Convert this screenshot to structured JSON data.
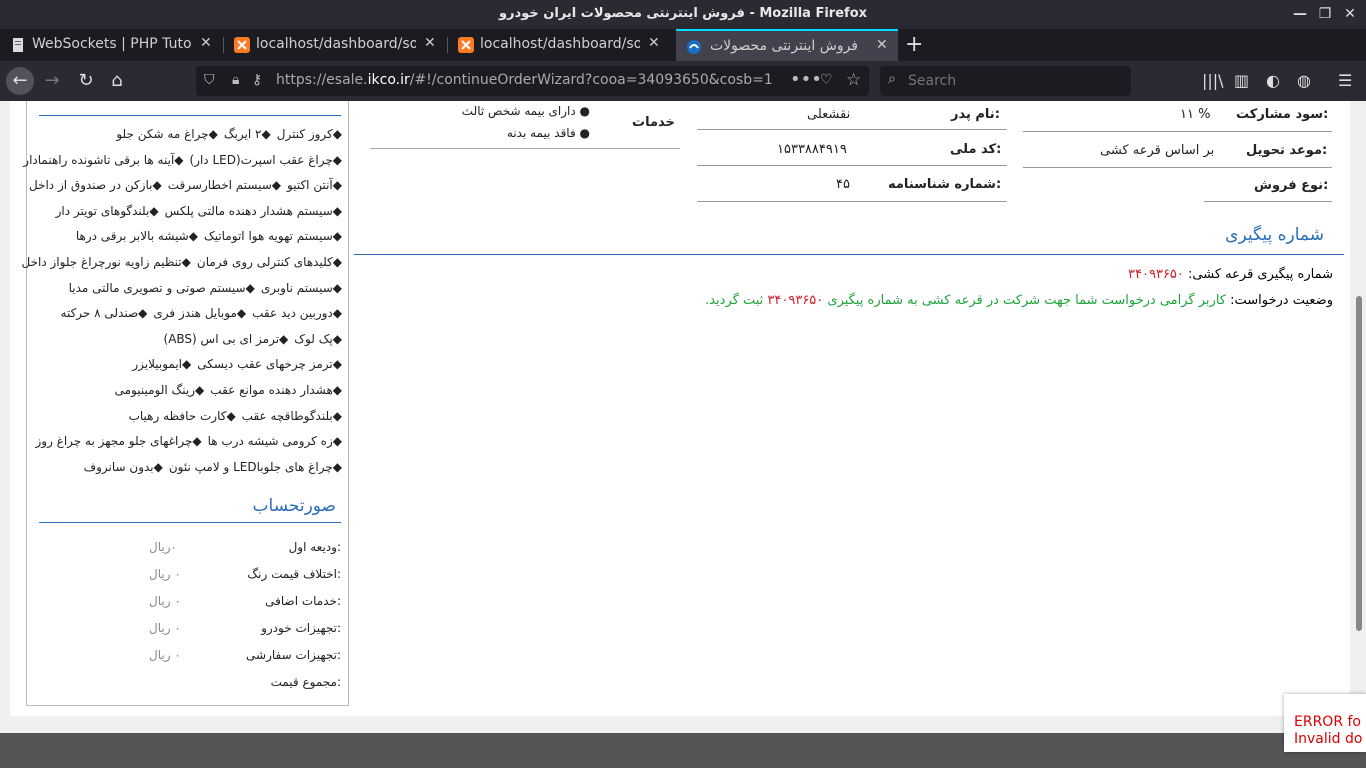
{
  "window": {
    "title": "فروش اینترنتی محصولات ایران خودرو - Mozilla Firefox"
  },
  "tabs": [
    {
      "label": "WebSockets | PHP Tutorial",
      "active": false
    },
    {
      "label": "localhost/dashboard/socke",
      "active": false
    },
    {
      "label": "localhost/dashboard/socke",
      "active": false
    },
    {
      "label": "فروش اینترنتی محصولات ایرا",
      "active": true
    }
  ],
  "navbar": {
    "url_prefix": "https://esale.",
    "url_domain": "ikco.ir",
    "url_rest": "/#!/continueOrderWizard?cooa=34093650&cosb=1",
    "search_placeholder": "Search"
  },
  "options": [
    [
      "◆کروز کنترل",
      "◆۲ ایربگ",
      "◆چراغ مه شکن جلو"
    ],
    [
      "◆چراغ عقب اسپرت(LED دار)",
      "◆آینه ها برقی تاشونده راهنمادار"
    ],
    [
      "◆آنتن اکتیو",
      "◆سیستم اخطارسرقت",
      "◆بازکن در صندوق از داخل"
    ],
    [
      "◆سیستم هشدار دهنده مالتی پلکس",
      "◆بلندگوهای تویتر دار"
    ],
    [
      "◆سیستم تهویه هوا اتوماتیک",
      "◆شیشه بالابر برقی درها"
    ],
    [
      "◆کلیدهای کنترلی روی فرمان",
      "◆تنظیم زاویه نورچراغ جلواز داخل"
    ],
    [
      "◆سیستم ناوبری",
      "◆سیستم صوتی و تصویری مالتی مدیا"
    ],
    [
      "◆دوربین دید عقب",
      "◆موبایل هندز فری",
      "◆صندلی ۸ حرکته"
    ],
    [
      "◆پک لوک",
      "◆ترمز ای بی اس (ABS)"
    ],
    [
      "◆ترمز چرخهای عقب دیسکی",
      "◆ایموبیلایزر"
    ],
    [
      "◆هشدار دهنده موانع عقب",
      "◆رینگ الومینیومی"
    ],
    [
      "◆بلندگوطاقچه عقب",
      "◆کارت حافظه رهیاب"
    ],
    [
      "◆زه کرومی شیشه درب ها",
      "◆چراغهای جلو مجهز به چراغ روز"
    ],
    [
      "◆چراغ های جلوباLED و لامپ نئون",
      "◆بدون سانروف"
    ]
  ],
  "invoice": {
    "title": "صورتحساب",
    "rows": [
      {
        "label": "ودیعه اول:",
        "value": "۰ریال"
      },
      {
        "label": "اختلاف قیمت رنگ:",
        "value": "۰ ریال"
      },
      {
        "label": "خدمات اضافی:",
        "value": "۰ ریال"
      },
      {
        "label": "تجهیزات خودرو:",
        "value": "۰ ریال"
      },
      {
        "label": "تجهیزات سفارشی:",
        "value": "۰ ریال"
      },
      {
        "label": "مجموع قیمت:",
        "value": ""
      }
    ]
  },
  "services": {
    "title": "خدمات",
    "items": [
      "دارای بیمه شخص ثالث",
      "فاقد بیمه بدنه"
    ]
  },
  "info": {
    "father_label": "نام پدر:",
    "father_value": "نقشعلی",
    "national_label": "کد ملی:",
    "national_value": "۱۵۳۳۸۸۴۹۱۹",
    "cert_label": "شماره شناسنامه:",
    "cert_value": "۴۵",
    "profit_label": "سود مشارکت:",
    "profit_value": "۱۱ %",
    "delivery_label": "موعد تحویل:",
    "delivery_value": "بر اساس قرعه کشی",
    "saletype_label": "نوع فروش:",
    "saletype_value": ""
  },
  "tracking": {
    "title": "شماره پیگیری",
    "lottery_label": "شماره پیگیری قرعه کشی:",
    "lottery_value": "۳۴۰۹۳۶۵۰",
    "status_label": "وضعیت درخواست:",
    "status_text_1": "کاربر گرامی درخواست شما جهت شرکت در قرعه کشی به شماره پیگیری",
    "status_number": "۳۴۰۹۳۶۵۰",
    "status_text_2": "ثبت گردید."
  },
  "error": {
    "line1": "ERROR fo",
    "line2": "Invalid do"
  },
  "colors": {
    "accent": "#2a6ebb",
    "error_red": "#d0202a",
    "success_green": "#1ea33a"
  }
}
